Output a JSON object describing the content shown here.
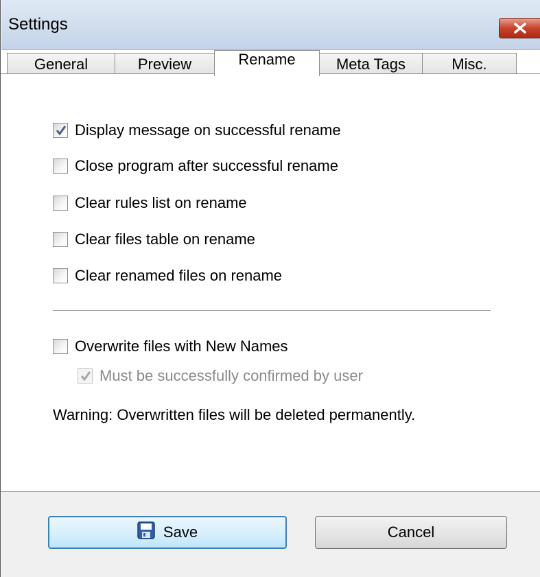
{
  "window": {
    "title": "Settings"
  },
  "tabs": [
    {
      "label": "General"
    },
    {
      "label": "Preview"
    },
    {
      "label": "Rename"
    },
    {
      "label": "Meta Tags"
    },
    {
      "label": "Misc."
    }
  ],
  "active_tab": "Rename",
  "options": [
    {
      "label": "Display message on successful rename",
      "checked": true
    },
    {
      "label": "Close program after successful rename",
      "checked": false
    },
    {
      "label": "Clear rules list on rename",
      "checked": false
    },
    {
      "label": "Clear files table on rename",
      "checked": false
    },
    {
      "label": "Clear renamed files on rename",
      "checked": false
    }
  ],
  "overwrite": {
    "label": "Overwrite files with New Names",
    "checked": false,
    "confirm_label": "Must be successfully confirmed by user",
    "confirm_checked": true,
    "confirm_enabled": false
  },
  "warning": "Warning: Overwritten files will be deleted permanently.",
  "buttons": {
    "save_label": "Save",
    "cancel_label": "Cancel"
  },
  "icons": {
    "save": "floppy-disk-icon",
    "close": "close-icon"
  },
  "colors": {
    "tick": "#4a5f8c",
    "close_button": "#c7442d",
    "default_border": "#3c7fb1"
  }
}
